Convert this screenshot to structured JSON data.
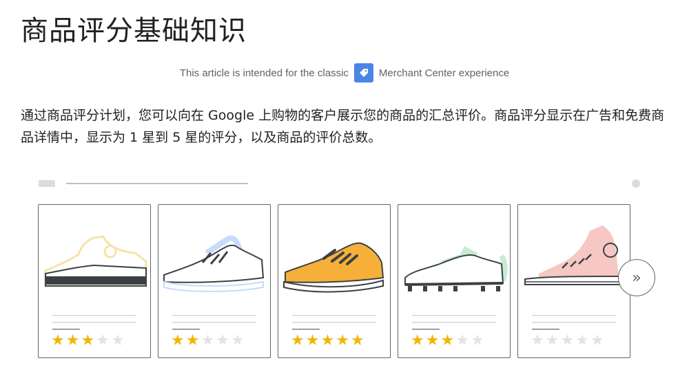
{
  "header": {
    "title": "商品评分基础知识"
  },
  "notice": {
    "prefix": "This article is intended for the classic",
    "suffix": "Merchant Center experience",
    "icon": "merchant-center-tag-icon",
    "icon_color": "#4a86e8"
  },
  "intro": {
    "paragraph": "通过商品评分计划，您可以向在 Google 上购物的客户展示您的商品的汇总评价。商品评分显示在广告和免费商品详情中，显示为 1 星到 5 星的评分，以及商品的评价总数。"
  },
  "illustration": {
    "next_button": {
      "icon": "double-chevron-right-icon",
      "glyph": "»"
    },
    "star_on_color": "#f4b400",
    "star_off_color": "#e3e3e3",
    "cards": [
      {
        "product": "sneaker-gray",
        "rating": 3,
        "max": 5
      },
      {
        "product": "running-shoe-blue",
        "rating": 2,
        "max": 5
      },
      {
        "product": "shoe-orange",
        "rating": 5,
        "max": 5
      },
      {
        "product": "cleat-green",
        "rating": 3,
        "max": 5
      },
      {
        "product": "high-top-pink",
        "rating": 0,
        "max": 5
      }
    ]
  }
}
